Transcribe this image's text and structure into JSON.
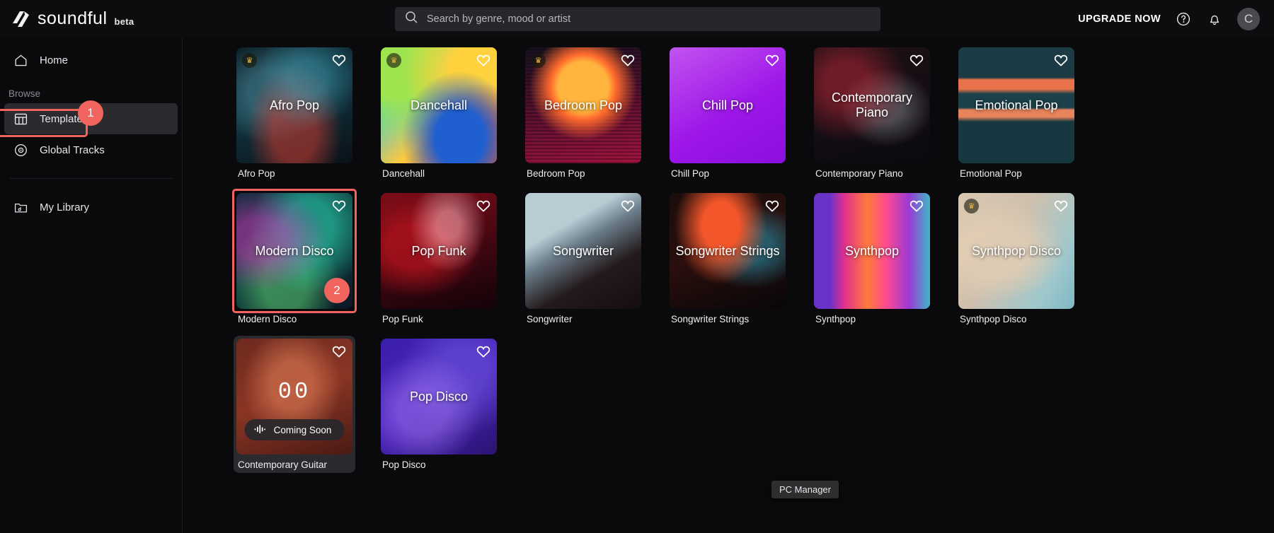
{
  "brand": {
    "name": "soundful",
    "tag": "beta",
    "logo_icon": "soundful-logo-icon"
  },
  "search": {
    "placeholder": "Search by genre, mood or artist",
    "value": "",
    "icon": "search-icon"
  },
  "topbar": {
    "upgrade_label": "UPGRADE NOW",
    "help_icon": "help-circle-icon",
    "notification_icon": "bell-icon",
    "avatar_initial": "C"
  },
  "sidebar": {
    "home": {
      "label": "Home",
      "icon": "home-icon"
    },
    "browse_label": "Browse",
    "items": [
      {
        "label": "Templates",
        "icon": "templates-grid-icon",
        "active": true
      },
      {
        "label": "Global Tracks",
        "icon": "disc-icon",
        "active": false
      }
    ],
    "library": {
      "label": "My Library",
      "icon": "folder-music-icon"
    }
  },
  "annotations": [
    {
      "id": "1",
      "target": "sidebar-item-templates",
      "color": "#f2655f"
    },
    {
      "id": "2",
      "target": "card-modern-disco",
      "color": "#f2655f"
    }
  ],
  "theme": {
    "accent": "#ef1a52",
    "annotation": "#f2655f",
    "background": "#0a0a0c",
    "topbar_bg": "#0d0d10",
    "active_nav_bg": "#2b2b2f"
  },
  "templates": [
    {
      "title": "Afro Pop",
      "label": "Afro Pop",
      "premium": true,
      "art": "art-afropop",
      "favorited": false
    },
    {
      "title": "Dancehall",
      "label": "Dancehall",
      "premium": true,
      "art": "art-dancehall",
      "favorited": false
    },
    {
      "title": "Bedroom Pop",
      "label": "Bedroom Pop",
      "premium": true,
      "art": "art-bedroompop",
      "favorited": false
    },
    {
      "title": "Chill Pop",
      "label": "Chill Pop",
      "premium": false,
      "art": "art-chillpop",
      "favorited": false
    },
    {
      "title": "Contemporary Piano",
      "label": "Contemporary Piano",
      "premium": false,
      "art": "art-contpiano",
      "favorited": false
    },
    {
      "title": "Emotional Pop",
      "label": "Emotional Pop",
      "premium": false,
      "art": "art-emotional",
      "favorited": false
    },
    {
      "title": "Modern Disco",
      "label": "Modern Disco",
      "premium": false,
      "art": "art-modern",
      "favorited": false,
      "annotated": "2"
    },
    {
      "title": "Pop Funk",
      "label": "Pop Funk",
      "premium": false,
      "art": "art-popfunk",
      "favorited": false
    },
    {
      "title": "Songwriter",
      "label": "Songwriter",
      "premium": false,
      "art": "art-songwriter",
      "favorited": false
    },
    {
      "title": "Songwriter Strings",
      "label": "Songwriter Strings",
      "premium": false,
      "art": "art-swstrings",
      "favorited": false
    },
    {
      "title": "Synthpop",
      "label": "Synthpop",
      "premium": false,
      "art": "art-synthpop",
      "favorited": false
    },
    {
      "title": "Synthpop Disco",
      "label": "Synthpop Disco",
      "premium": true,
      "art": "art-synthdisco",
      "favorited": false
    },
    {
      "title": "",
      "label": "Contemporary Guitar",
      "premium": false,
      "art": "art-contguitar",
      "favorited": false,
      "coming_soon": true,
      "coming_soon_label": "Coming Soon",
      "counter": "00",
      "hovered": true
    },
    {
      "title": "Pop Disco",
      "label": "Pop Disco",
      "premium": false,
      "art": "art-popdisco",
      "favorited": false
    }
  ],
  "tooltip": {
    "text": "PC Manager"
  },
  "fab": {
    "icon": "equalizer-icon",
    "color": "#ef1a52"
  }
}
